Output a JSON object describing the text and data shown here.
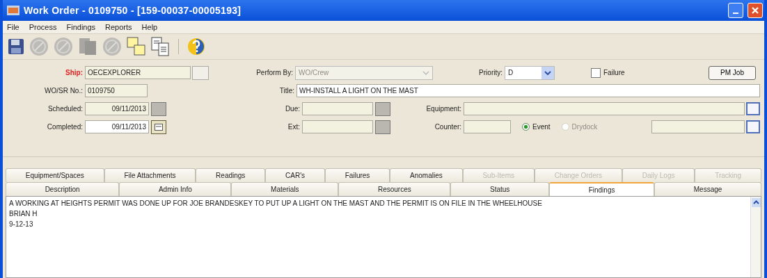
{
  "window": {
    "title": "Work Order - 0109750 - [159-00037-00005193]"
  },
  "menu": [
    {
      "label": "File"
    },
    {
      "label": "Process"
    },
    {
      "label": "Findings"
    },
    {
      "label": "Reports"
    },
    {
      "label": "Help"
    }
  ],
  "toolbar": [
    {
      "kind": "save",
      "disabled": false
    },
    {
      "kind": "disc",
      "disabled": true
    },
    {
      "kind": "disc",
      "disabled": true
    },
    {
      "kind": "pages",
      "disabled": true
    },
    {
      "kind": "disc",
      "disabled": true
    },
    {
      "kind": "copy",
      "disabled": false
    },
    {
      "kind": "doc",
      "disabled": false
    },
    {
      "kind": "help",
      "disabled": false
    }
  ],
  "form": {
    "ship": {
      "label": "Ship:",
      "value": "OECEXPLORER"
    },
    "perform_by": {
      "label": "Perform By:",
      "value": "WO/Crew",
      "disabled": true
    },
    "priority": {
      "label": "Priority:",
      "value": "D"
    },
    "failure": {
      "label": "Failure",
      "checked": false
    },
    "pm_job": {
      "label": "PM Job"
    },
    "wo_sr_no": {
      "label": "WO/SR No.:",
      "value": "0109750"
    },
    "title": {
      "label": "Title:",
      "value": "WH-INSTALL A LIGHT ON THE MAST"
    },
    "scheduled": {
      "label": "Scheduled:",
      "value": "09/11/2013",
      "disabled": true
    },
    "due": {
      "label": "Due:"
    },
    "equipment": {
      "label": "Equipment:"
    },
    "completed": {
      "label": "Completed:",
      "value": "09/11/2013",
      "disabled": false
    },
    "ext": {
      "label": "Ext:"
    },
    "counter": {
      "label": "Counter:"
    },
    "radios": [
      {
        "label": "Event",
        "selected": true,
        "disabled": false
      },
      {
        "label": "Drydock",
        "selected": false,
        "disabled": true
      }
    ]
  },
  "tabs_row_1": [
    {
      "label": "Equipment/Spaces",
      "disabled": false
    },
    {
      "label": "File Attachments",
      "disabled": false
    },
    {
      "label": "Readings",
      "disabled": false
    },
    {
      "label": "CAR's",
      "disabled": false
    },
    {
      "label": "Failures",
      "disabled": false
    },
    {
      "label": "Anomalies",
      "disabled": false
    },
    {
      "label": "Sub-Items",
      "disabled": true
    },
    {
      "label": "Change Orders",
      "disabled": true
    },
    {
      "label": "Daily Logs",
      "disabled": true
    },
    {
      "label": "Tracking",
      "disabled": true
    }
  ],
  "tabs_row_2": [
    {
      "label": "Description",
      "selected": false
    },
    {
      "label": "Admin Info",
      "selected": false
    },
    {
      "label": "Materials",
      "selected": false
    },
    {
      "label": "Resources",
      "selected": false
    },
    {
      "label": "Status",
      "selected": false
    },
    {
      "label": "Findings",
      "selected": true
    },
    {
      "label": "Message",
      "selected": false
    }
  ],
  "findings_text": [
    "A WORKING AT HEIGHTS PERMIT WAS DONE UP FOR JOE BRANDESKEY TO PUT UP A LIGHT ON THE MAST AND THE PERMIT IS ON FILE IN THE WHEELHOUSE",
    "BRIAN H",
    "9-12-13"
  ]
}
